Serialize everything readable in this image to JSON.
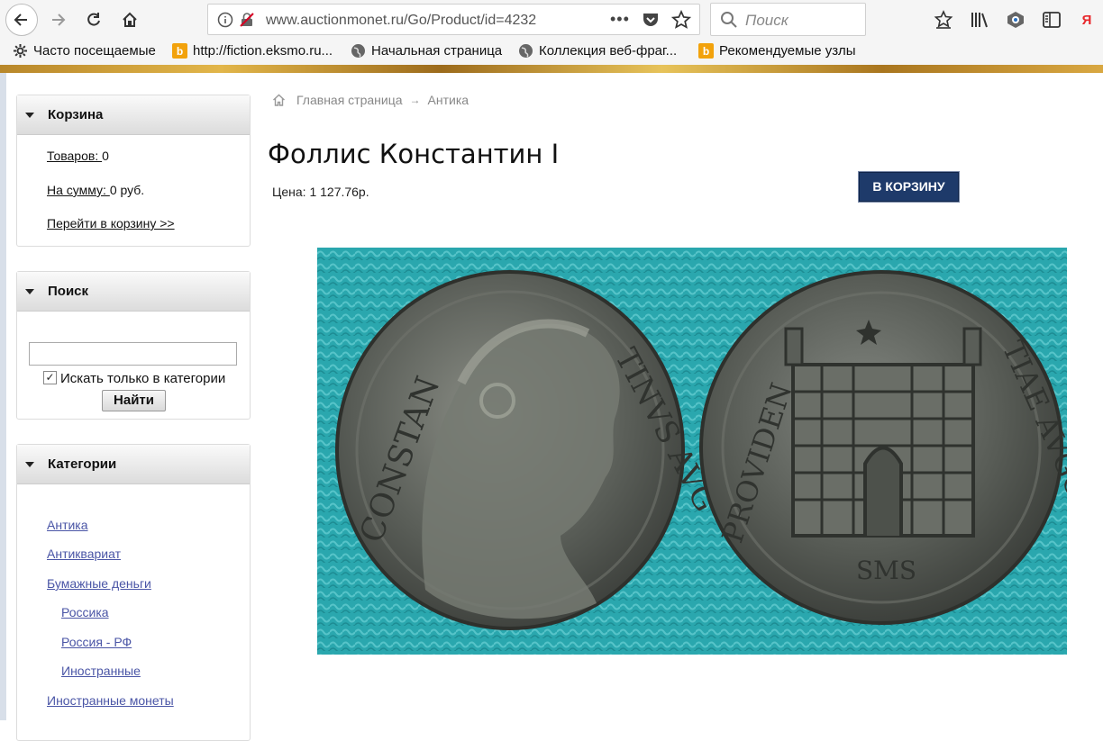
{
  "browser": {
    "url": "www.auctionmonet.ru/Go/Product/id=4232",
    "search_placeholder": "Поиск",
    "bookmarks": [
      {
        "label": "Часто посещаемые"
      },
      {
        "label": "http://fiction.eksmo.ru..."
      },
      {
        "label": "Начальная страница"
      },
      {
        "label": "Коллекция веб-фраг..."
      },
      {
        "label": "Рекомендуемые узлы"
      }
    ]
  },
  "sidebar": {
    "cart": {
      "title": "Корзина",
      "items_label": "Товаров: ",
      "items_value": "0",
      "sum_label": "На сумму: ",
      "sum_value": "0 руб.",
      "goto_link": "Перейти в корзину >>"
    },
    "search": {
      "title": "Поиск",
      "input_value": "",
      "checkbox_label": "Искать только в категории",
      "checkbox_checked": true,
      "button": "Найти"
    },
    "categories": {
      "title": "Категории",
      "items": [
        {
          "label": "Антика"
        },
        {
          "label": "Антиквариат"
        },
        {
          "label": "Бумажные деньги"
        },
        {
          "label": "Россика"
        },
        {
          "label": "Россия - РФ"
        },
        {
          "label": "Иностранные"
        },
        {
          "label": "Иностранные монеты"
        }
      ]
    }
  },
  "breadcrumb": {
    "home": "Главная страница",
    "separator": "→",
    "current": "Антика"
  },
  "product": {
    "title": "Фоллис Константин I",
    "price": "Цена: 1 127.76р.",
    "cart_button": "В КОРЗИНУ",
    "coin_left_legend": "CONSTANTINVS AVG",
    "coin_right_legend": "PROVIDENTIAE AVGG",
    "coin_exergue": "SMS"
  },
  "colors": {
    "link": "#4a55a6",
    "cart_button_bg": "#1e3a6a",
    "photo_background": "#2aa7ae"
  }
}
